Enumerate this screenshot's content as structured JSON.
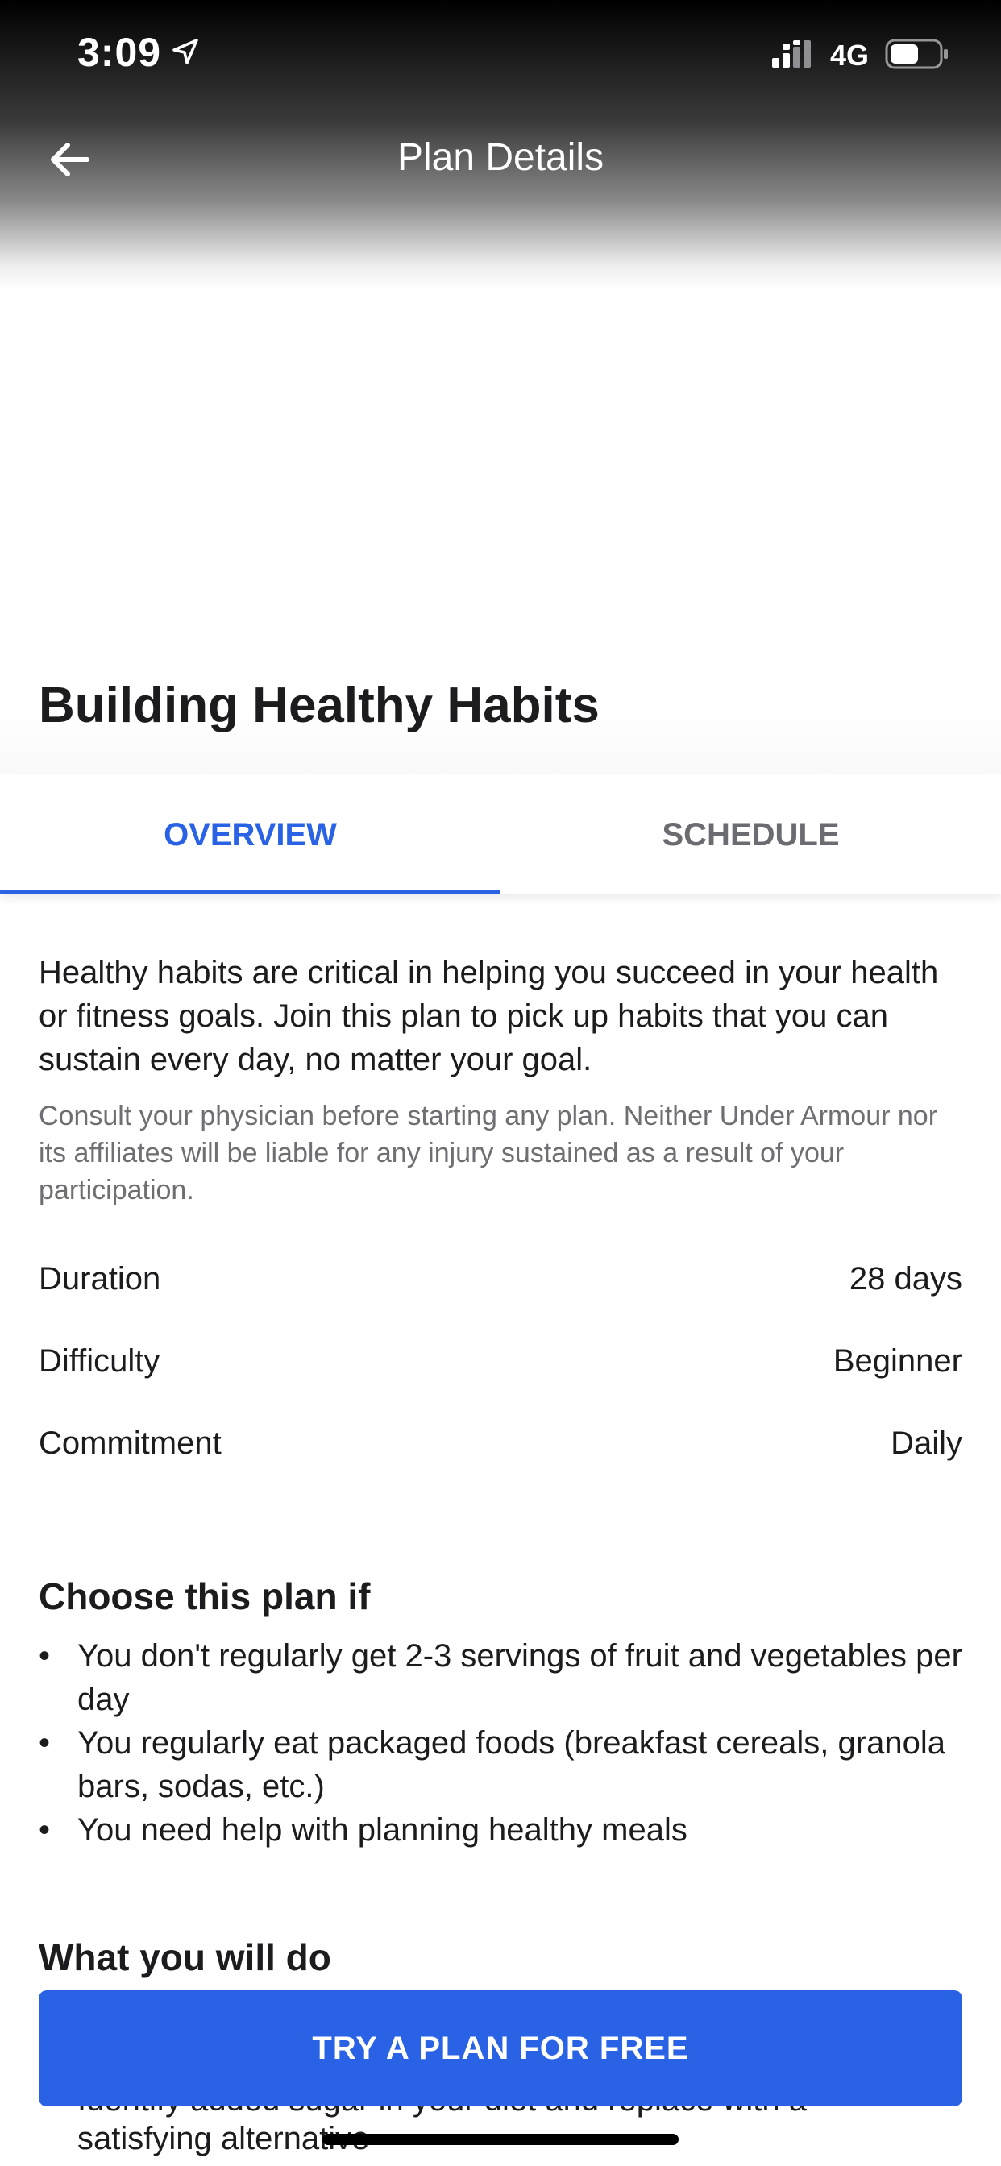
{
  "status_bar": {
    "time": "3:09",
    "network": "4G",
    "icons": [
      "location-arrow-icon",
      "signal-icon",
      "battery-icon"
    ]
  },
  "nav": {
    "title": "Plan Details",
    "back_icon": "arrow-left-icon"
  },
  "plan": {
    "title": "Building Healthy Habits"
  },
  "tabs": [
    {
      "label": "OVERVIEW",
      "active": true
    },
    {
      "label": "SCHEDULE",
      "active": false
    }
  ],
  "overview": {
    "description": "Healthy habits are critical in helping you succeed in your health or fitness goals. Join this plan to pick up habits that you can sustain every day, no matter your goal.",
    "disclaimer": "Consult your physician before starting any plan. Neither Under Armour nor its affiliates will be liable for any injury sustained as a result of your participation.",
    "details": [
      {
        "label": "Duration",
        "value": "28 days"
      },
      {
        "label": "Difficulty",
        "value": "Beginner"
      },
      {
        "label": "Commitment",
        "value": "Daily"
      }
    ],
    "choose_title": "Choose this plan if",
    "choose_items": [
      "You don't regularly get 2-3 servings of fruit and vegetables per day",
      "You regularly eat packaged foods (breakfast cereals, granola bars, sodas, etc.)",
      "You need help with planning healthy meals"
    ],
    "what_title": "What you will do",
    "what_items_partial": [
      "Identify added sugar in your diet and replace with a",
      "satisfying alternative"
    ]
  },
  "cta": {
    "label": "TRY A PLAN FOR FREE"
  },
  "colors": {
    "accent": "#2962e5",
    "text": "#1c1c1e",
    "muted": "#6e6e73"
  }
}
